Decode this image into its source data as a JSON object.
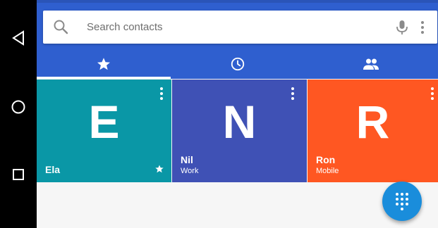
{
  "nav": {
    "back_icon": "back-triangle-icon",
    "home_icon": "home-circle-icon",
    "recents_icon": "recents-square-icon"
  },
  "search": {
    "placeholder": "Search contacts",
    "value": ""
  },
  "tabs": [
    {
      "icon": "star-icon"
    },
    {
      "icon": "clock-icon"
    },
    {
      "icon": "people-icon"
    }
  ],
  "favorites": [
    {
      "letter": "E",
      "name": "Ela",
      "label": "",
      "color": "#0a97a6",
      "starred": true
    },
    {
      "letter": "N",
      "name": "Nil",
      "label": "Work",
      "color": "#3f51b5",
      "starred": false
    },
    {
      "letter": "R",
      "name": "Ron",
      "label": "Mobile",
      "color": "#ff5722",
      "starred": false
    }
  ],
  "colors": {
    "app_bar": "#2f5fcf",
    "fab": "#1a8ddb"
  },
  "fab": {
    "icon": "dialpad-icon"
  }
}
